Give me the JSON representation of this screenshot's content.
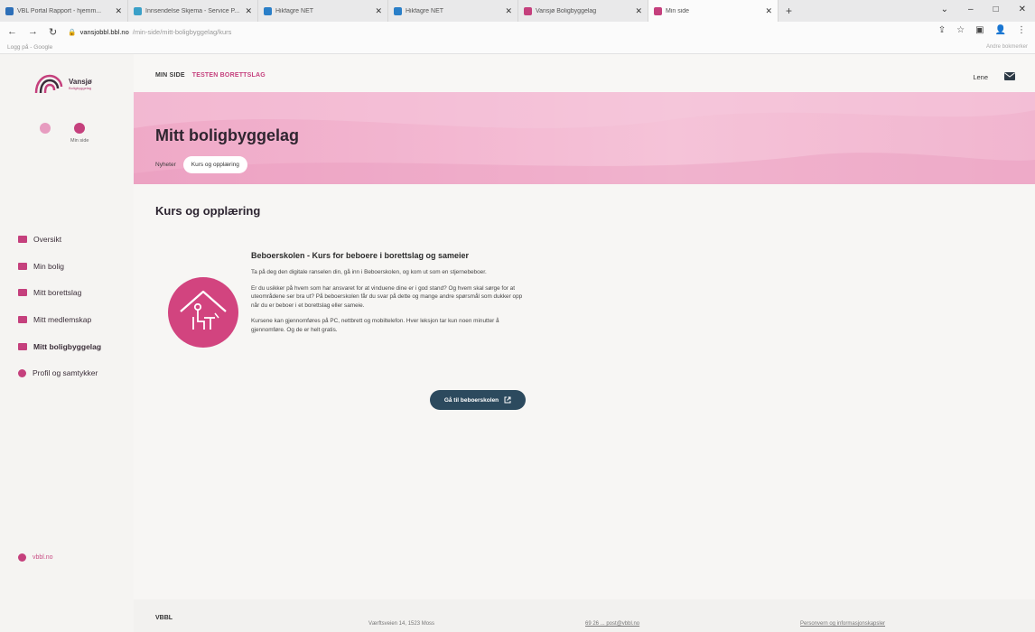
{
  "browser": {
    "tabs": [
      {
        "title": "VBL Portal Rapport - hjemm...",
        "color": "#2d6fb8",
        "active": false
      },
      {
        "title": "Innsendelse Skjema - Service P...",
        "color": "#3aa0c8",
        "active": false
      },
      {
        "title": "Hikfagre NET",
        "color": "#2a7fc8",
        "active": false
      },
      {
        "title": "Hikfagre NET",
        "color": "#2a7fc8",
        "active": false
      },
      {
        "title": "Vansjø Boligbyggelag",
        "color": "#c5407d",
        "active": false
      },
      {
        "title": "Min side",
        "color": "#c5407d",
        "active": true
      }
    ],
    "new_tab": "+",
    "url_host": "vansjobbl.bbl.no",
    "url_path": "/min-side/mitt-boligbyggelag/kurs",
    "bookmarks_left": "Logg på - Google",
    "bookmarks_right": "Andre bokmerker",
    "win_minimize": "–",
    "win_maximize": "□",
    "win_close": "✕"
  },
  "sidebar": {
    "logo_text": "Vansjø",
    "logo_sub": "Boligbyggelag",
    "quick_links": [
      {
        "label": "",
        "color": "#e79cc0"
      },
      {
        "label": "Min side",
        "color": "#c5407d"
      }
    ],
    "menu": [
      {
        "label": "Oversikt",
        "active": false
      },
      {
        "label": "Min bolig",
        "active": false
      },
      {
        "label": "Mitt borettslag",
        "active": false
      },
      {
        "label": "Mitt medlemskap",
        "active": false
      },
      {
        "label": "Mitt boligbyggelag",
        "active": true
      },
      {
        "label": "Profil og samtykker",
        "active": false
      }
    ],
    "footer_link": "vbbl.no"
  },
  "topnav": {
    "link1": "MIN SIDE",
    "link2": "TESTEN BORETTSLAG",
    "user": "Lene"
  },
  "hero": {
    "title": "Mitt boligbyggelag",
    "tab1": "Nyheter",
    "tab2": "Kurs og opplæring"
  },
  "main": {
    "heading": "Kurs og opplæring",
    "course": {
      "title": "Beboerskolen - Kurs for beboere i borettslag og sameier",
      "p1": "Ta på deg den digitale ranselen din, gå inn i Beboerskolen, og kom ut som en stjernebeboer.",
      "p2": "Er du usikker på hvem som har ansvaret for at vinduene dine er i god stand? Og hvem skal sørge for at uteområdene ser bra ut? På beboerskolen får du svar på dette og mange andre spørsmål som dukker opp når du er beboer i et borettslag eller sameie.",
      "p3": "Kursene kan gjennomføres på PC, nettbrett og mobiltelefon. Hver leksjon tar kun noen minutter å gjennomføre. Og de er helt gratis.",
      "cta": "Gå til beboerskolen"
    }
  },
  "footer": {
    "brand": "VBBL",
    "address": "Værftsveien 14, 1523 Moss",
    "contact": "69 26 ... post@vbbl.no",
    "privacy": "Personvern og informasjonskapsler"
  },
  "colors": {
    "brand": "#c5407d",
    "cta": "#2c4a5e"
  }
}
